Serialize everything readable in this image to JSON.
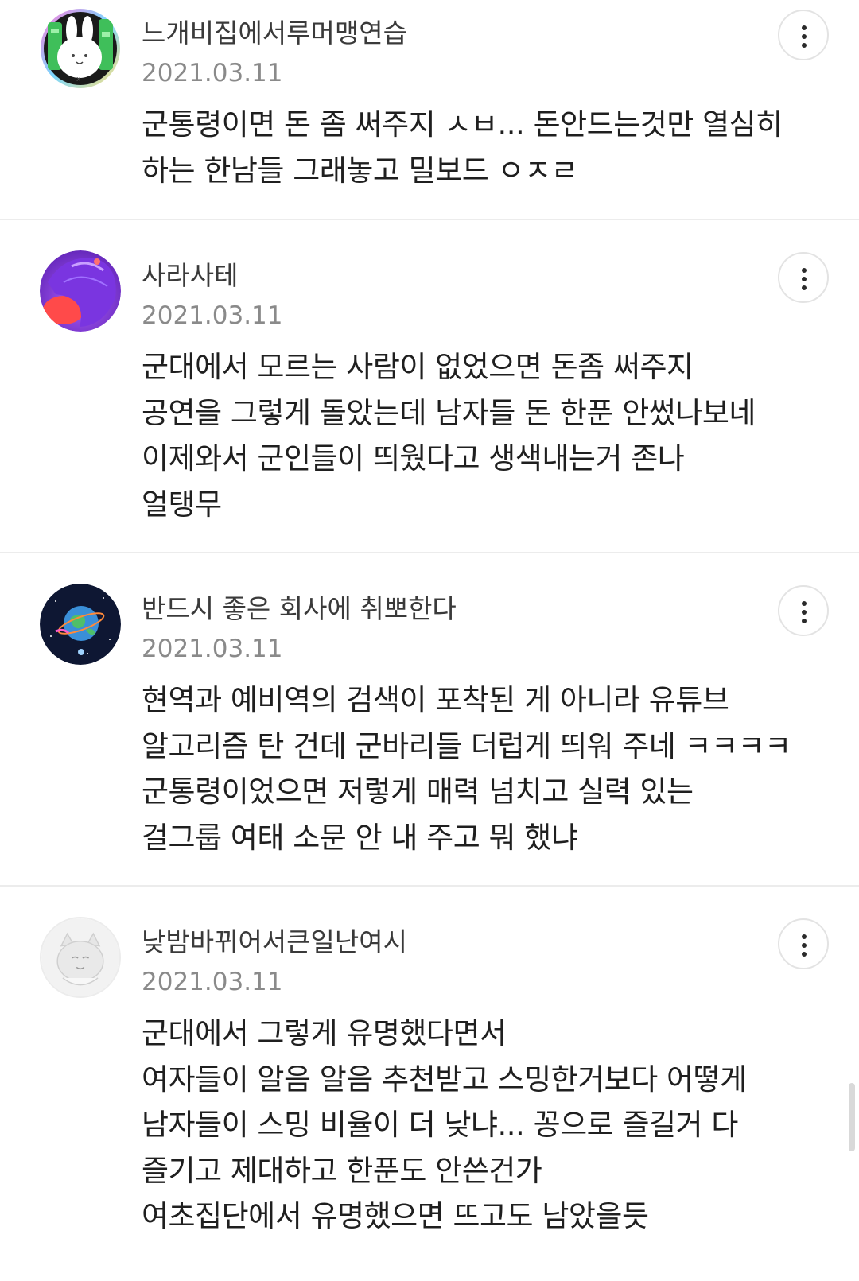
{
  "comments": [
    {
      "nickname": "느개비집에서루머맹연습",
      "date": "2021.03.11",
      "text": "군통령이면 돈 좀 써주지 ㅅㅂ... 돈안드는것만 열심히\n하는 한남들 그래놓고 밀보드 ㅇㅈㄹ",
      "avatar": "white-rabbit-green-avatar"
    },
    {
      "nickname": "사라사테",
      "date": "2021.03.11",
      "text": "군대에서 모르는 사람이 없었으면 돈좀 써주지\n공연을 그렇게 돌았는데 남자들 돈 한푼 안썼나보네\n이제와서 군인들이 띄웠다고 생색내는거 존나\n얼탱무",
      "avatar": "purple-hair-avatar"
    },
    {
      "nickname": "반드시 좋은 회사에 취뽀한다",
      "date": "2021.03.11",
      "text": "현역과 예비역의 검색이 포착된 게 아니라 유튜브\n알고리즘 탄 건데 군바리들 더럽게 띄워 주네 ㅋㅋㅋㅋ\n군통령이었으면 저렇게 매력 넘치고 실력 있는\n걸그룹 여태 소문 안 내 주고 뭐 했냐",
      "avatar": "space-earth-avatar"
    },
    {
      "nickname": "낮밤바뀌어서큰일난여시",
      "date": "2021.03.11",
      "text": "군대에서 그렇게 유명했다면서\n여자들이 알음 알음 추천받고 스밍한거보다 어떻게\n남자들이 스밍 비율이 더 낮냐... 꽁으로 즐길거 다\n즐기고 제대하고 한푼도 안쓴건가\n여초집단에서 유명했으면 뜨고도 남았을듯",
      "avatar": "default-fox-avatar"
    }
  ],
  "icons": {
    "more": "vertical-ellipsis-icon"
  },
  "colors": {
    "text": "#1f1f1f",
    "nickname": "#3a3a3a",
    "date": "#8a8a8a",
    "divider": "#ececec",
    "button_border": "#e3e3e3"
  }
}
